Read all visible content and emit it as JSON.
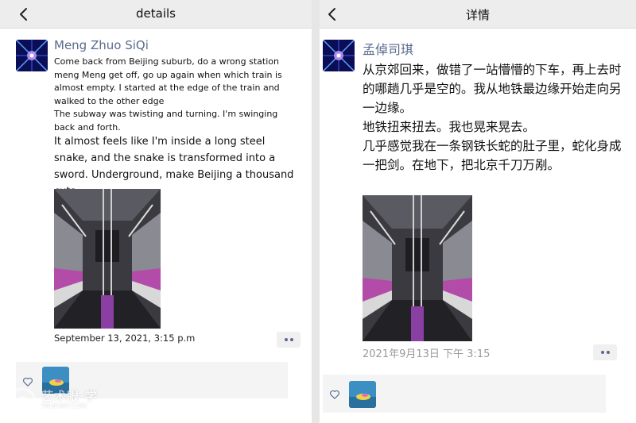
{
  "left": {
    "nav_title": "details",
    "author": "Meng Zhuo SiQi",
    "post": {
      "para1": "Come back from Beijing suburb, do a wrong station meng Meng get off, go up again when which train is almost empty. I started at the edge of the train and walked to the other edge",
      "para2": "The subway was twisting and turning. I'm swinging back and forth.",
      "para3": "It almost feels like I'm inside a long steel snake, and the snake is transformed into a sword. Underground, make Beijing a thousand cuts."
    },
    "timestamp": "September 13, 2021, 3:15 p.m"
  },
  "right": {
    "nav_title": "详情",
    "author": "孟倬司琪",
    "post": {
      "text": "从京郊回来，做错了一站懵懵的下车，再上去时的哪趟几乎是空的。我从地铁最边缘开始走向另一边缘。\n地铁扭来扭去。我也晃来晃去。\n几乎感觉我在一条钢铁长蛇的肚子里，蛇化身成一把剑。在地下，把北京千刀万剐。"
    },
    "timestamp": "2021年9月13日 下午 3:15"
  },
  "icons": {
    "back": "chevron-left-icon",
    "more": "more-dots-icon",
    "like": "heart-outline-icon"
  },
  "watermark": {
    "title": "艺术眼·学",
    "subtitle": "TRUEART.COM"
  },
  "colors": {
    "nav_bg": "#ededed",
    "author_name": "#5a6a8e",
    "timestamp_right": "#9a9a9a",
    "likes_bg": "#f4f4f4"
  }
}
